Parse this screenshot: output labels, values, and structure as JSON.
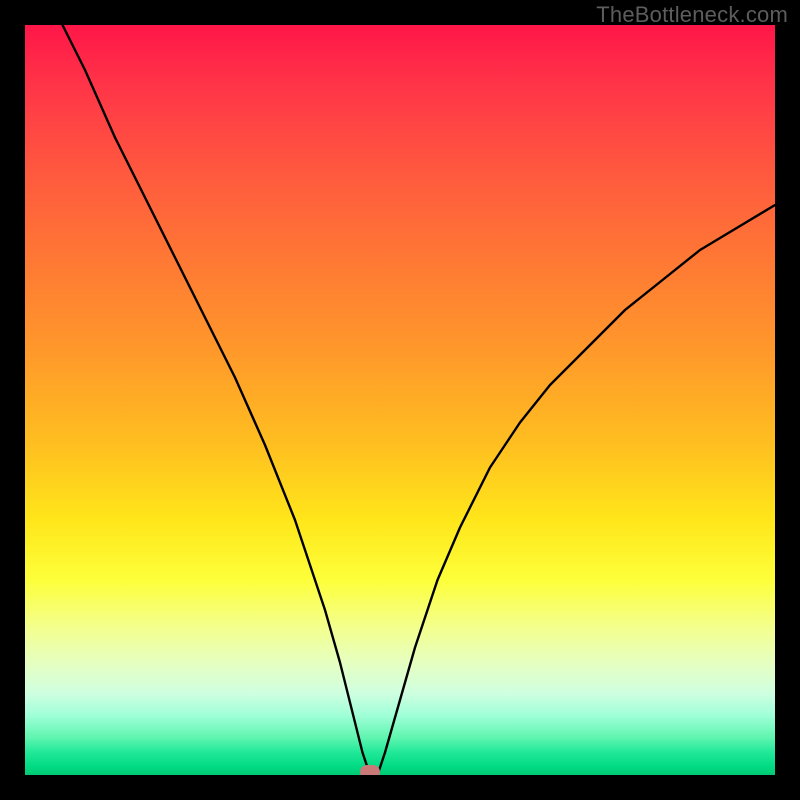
{
  "watermark": "TheBottleneck.com",
  "chart_data": {
    "type": "line",
    "title": "",
    "xlabel": "",
    "ylabel": "",
    "xlim": [
      0,
      100
    ],
    "ylim": [
      0,
      100
    ],
    "grid": false,
    "series": [
      {
        "name": "curve",
        "x": [
          5,
          8,
          12,
          16,
          20,
          24,
          28,
          32,
          36,
          38,
          40,
          42,
          44,
          45,
          46,
          47,
          48,
          50,
          52,
          55,
          58,
          62,
          66,
          70,
          75,
          80,
          85,
          90,
          95,
          100
        ],
        "y": [
          100,
          94,
          85,
          77,
          69,
          61,
          53,
          44,
          34,
          28,
          22,
          15,
          7,
          3,
          0,
          0,
          3,
          10,
          17,
          26,
          33,
          41,
          47,
          52,
          57,
          62,
          66,
          70,
          73,
          76
        ]
      }
    ],
    "marker": {
      "x": 46,
      "y": 0
    },
    "background_gradient": {
      "top_color": "#ff1648",
      "mid_color": "#ffe61a",
      "bottom_color": "#00c874"
    }
  }
}
